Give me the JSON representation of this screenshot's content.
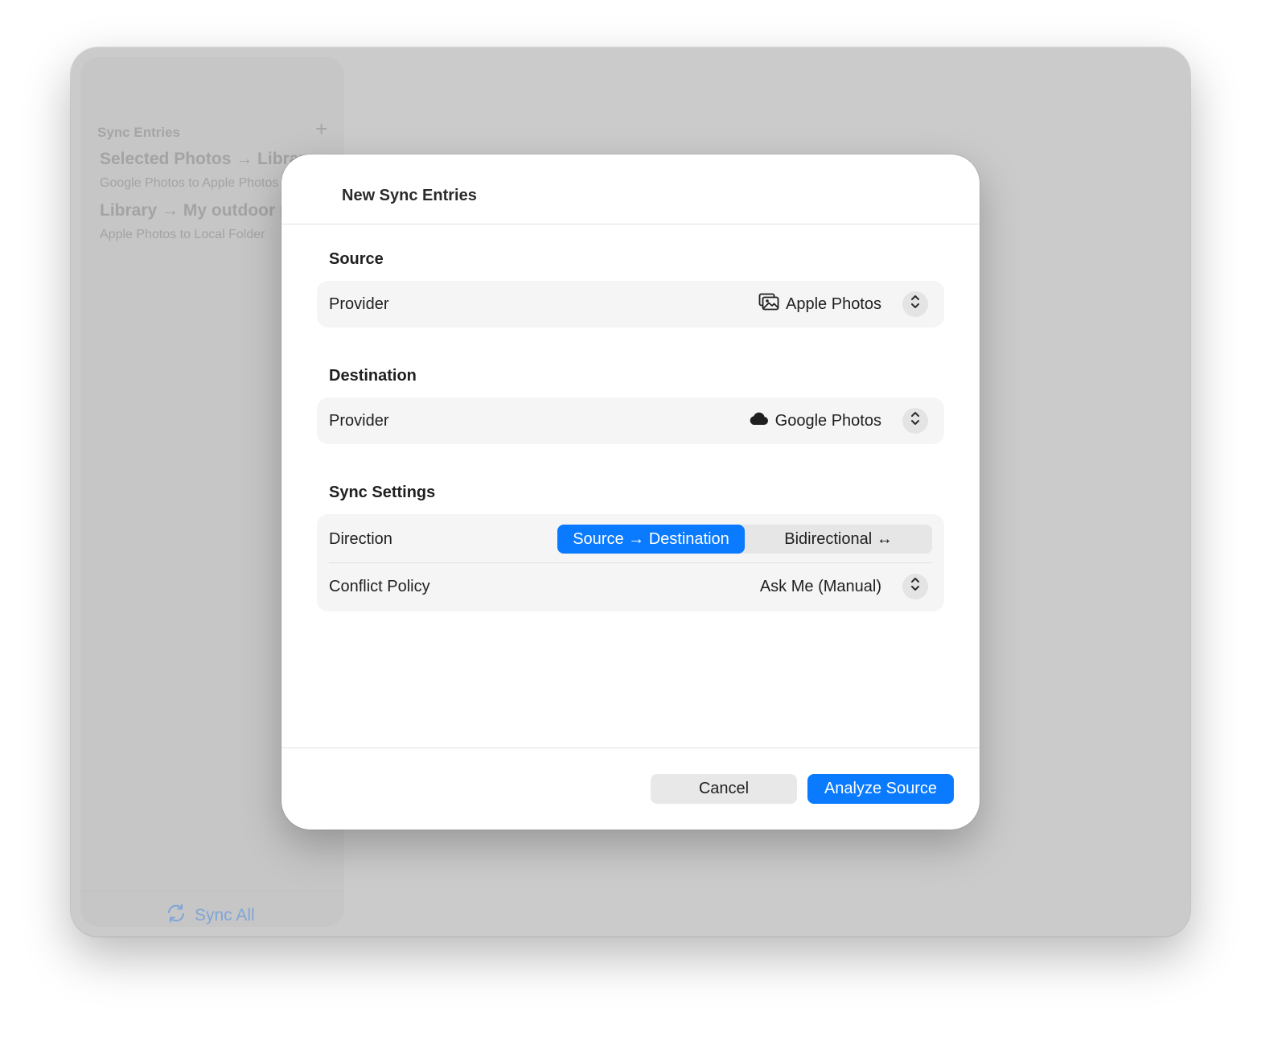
{
  "sidebar": {
    "header": "Sync Entries",
    "add_label": "+",
    "items": [
      {
        "title": "Selected Photos → Library",
        "subtitle": "Google Photos to Apple Photos"
      },
      {
        "title": "Library → My outdoor p",
        "subtitle": "Apple Photos to Local Folder"
      }
    ],
    "sync_all_label": "Sync All"
  },
  "dialog": {
    "title": "New Sync Entries",
    "source": {
      "section_label": "Source",
      "provider_label": "Provider",
      "provider_value": "Apple Photos",
      "provider_icon": "photos-icon"
    },
    "destination": {
      "section_label": "Destination",
      "provider_label": "Provider",
      "provider_value": "Google Photos",
      "provider_icon": "cloud-icon"
    },
    "settings": {
      "section_label": "Sync Settings",
      "direction_label": "Direction",
      "direction_options": [
        "Source → Destination",
        "Bidirectional ↔"
      ],
      "direction_selected": "Source → Destination",
      "conflict_label": "Conflict Policy",
      "conflict_value": "Ask Me (Manual)"
    },
    "cancel_label": "Cancel",
    "primary_label": "Analyze Source"
  },
  "colors": {
    "accent": "#0a7aff",
    "window_bg": "#cbcbcb",
    "sidebar_text": "#a3a3a3",
    "sync_all": "#7fa5d8"
  }
}
